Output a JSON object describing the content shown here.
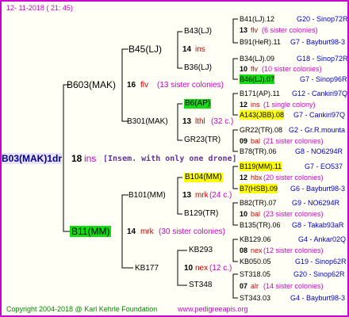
{
  "date": "12- 11-2018 ( 21: 45)",
  "footer": {
    "copyright": "Copyright 2004-2018 @ Karl Kehrle Foundation",
    "website": "www.pedigreeapis.org"
  },
  "root": {
    "name": "B03(MAK)1dr",
    "num": "18",
    "code": "ins",
    "note": "[Insem. with only one drone]"
  },
  "gen1": {
    "top": {
      "name": "B603(MAK)",
      "num": "16",
      "code": "flv",
      "note": "(13 sister colonies)"
    },
    "bottom": {
      "name": "B11(MM)",
      "num": "14",
      "code": "mrk",
      "note": "(30 sister colonies)"
    }
  },
  "gen2": {
    "a": {
      "name": "B45(LJ)",
      "num": "14",
      "code": "ins"
    },
    "b": {
      "name": "B301(MAK)",
      "num": "13",
      "code": "lthl",
      "note": "(32 c.)"
    },
    "c": {
      "name": "B101(MM)",
      "num": "13",
      "code": "mrk",
      "note": "(24 c.)"
    },
    "d": {
      "name": "KB177",
      "num": "10",
      "code": "nex",
      "note": "(12 c.)"
    }
  },
  "gen3": {
    "a": {
      "name": "B43(LJ)"
    },
    "b": {
      "name": "B36(LJ)"
    },
    "c": {
      "name": "B6(AP)"
    },
    "d": {
      "name": "GR23(TR)"
    },
    "e": {
      "name": "B104(MM)"
    },
    "f": {
      "name": "B129(TR)"
    },
    "g": {
      "name": "KB293"
    },
    "h": {
      "name": "ST348"
    }
  },
  "gen4": [
    {
      "parent": "B41(LJ).12",
      "parent_src": "G20 - Sinop72R",
      "num": "13",
      "code": "flv",
      "note": "(6 sister colonies)",
      "sire": "B91(HeR).11",
      "sire_src": "G7 - Bayburt98-3"
    },
    {
      "parent": "B34(LJ).09",
      "parent_src": "G18 - Sinop72R",
      "num": "10",
      "code": "flv",
      "note": "(10 sister colonies)",
      "sire": "B46(LJ).07",
      "sire_src": "G7 - Sinop96R"
    },
    {
      "parent": "B171(AP).11",
      "parent_src": "G12 - Cankiri97Q",
      "num": "12",
      "code": "ins",
      "note": "(1 single colony)",
      "sire": "A143(JBB).08",
      "sire_src": "G7 - Cankiri97Q"
    },
    {
      "parent": "GR22(TR).08",
      "parent_src": "G2 - Gr.R.mounta",
      "num": "09",
      "code": "bal",
      "note": "(21 sister colonies)",
      "sire": "B78(TR).06",
      "sire_src": "G8 - NO6294R"
    },
    {
      "parent": "B119(MM).11",
      "parent_src": "G7 - EO537",
      "num": "12",
      "code": "hbx",
      "note": "(20 sister colonies)",
      "sire": "B7(HSB).09",
      "sire_src": "G6 - Bayburt98-3"
    },
    {
      "parent": "B82(TR).07",
      "parent_src": "G9 - NO6294R",
      "num": "10",
      "code": "bal",
      "note": "(23 sister colonies)",
      "sire": "B135(TR).06",
      "sire_src": "G8 - Takab93aR"
    },
    {
      "parent": "KB129.06",
      "parent_src": "G4 - Ankar02Q",
      "num": "08",
      "code": "nex",
      "note": "(12 sister colonies)",
      "sire": "KB050.05",
      "sire_src": "G19 - Sinop62R"
    },
    {
      "parent": "ST318.05",
      "parent_src": "G20 - Sinop62R",
      "num": "07",
      "code": "alr",
      "note": "(14 sister colonies)",
      "sire": "ST343.03",
      "sire_src": "G4 - Bayburt98-3"
    }
  ]
}
